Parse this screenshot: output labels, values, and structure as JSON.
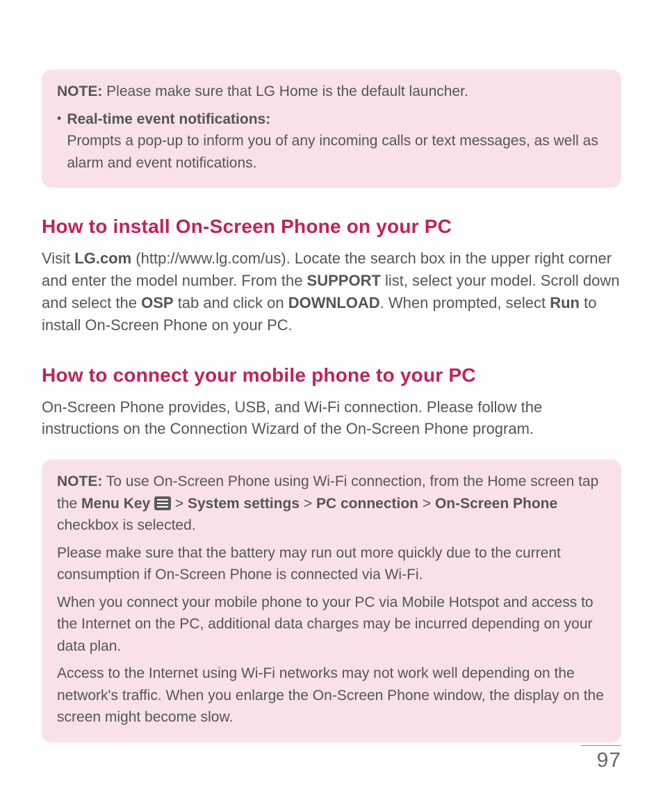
{
  "note1": {
    "label": "NOTE:",
    "intro": " Please make sure that LG Home is the default launcher.",
    "bullet_title": "Real-time event notifications:",
    "bullet_text": "Prompts a pop-up to inform you of any incoming calls or text messages, as well as alarm and event notifications."
  },
  "section_install": {
    "heading": "How to install On-Screen Phone on your PC",
    "p1_a": "Visit ",
    "p1_b": "LG.com",
    "p1_c": " (http://www.lg.com/us). Locate the search box in the upper right corner and enter the model number. From the ",
    "p1_d": "SUPPORT",
    "p1_e": " list, select your model. Scroll down and select the ",
    "p1_f": "OSP",
    "p1_g": " tab and click on ",
    "p1_h": "DOWNLOAD",
    "p1_i": ". When prompted, select ",
    "p1_j": "Run",
    "p1_k": " to install On-Screen Phone on your PC."
  },
  "section_connect": {
    "heading": "How to connect your mobile phone to your PC",
    "p1": "On-Screen Phone provides, USB, and Wi-Fi connection. Please follow the instructions on the Connection Wizard of the On-Screen Phone program."
  },
  "note2": {
    "label": "NOTE:",
    "a": " To use On-Screen Phone using Wi-Fi connection, from the Home screen tap the ",
    "menu_key": "Menu Key",
    "sep": " > ",
    "system_settings": "System settings",
    "pc_connection": "PC connection",
    "osp": "On-Screen Phone",
    "b": " checkbox is selected.",
    "p2": "Please make sure that the battery may run out more quickly due to the current consumption if On-Screen Phone is connected via Wi-Fi.",
    "p3": "When you connect your mobile phone to your PC via Mobile Hotspot and access to the Internet on the PC, additional data charges may be incurred depending on your data plan.",
    "p4": "Access to the Internet using Wi-Fi networks may not work well depending on the network's traffic. When you enlarge the On-Screen Phone window, the display on the screen might become slow."
  },
  "page_number": "97"
}
